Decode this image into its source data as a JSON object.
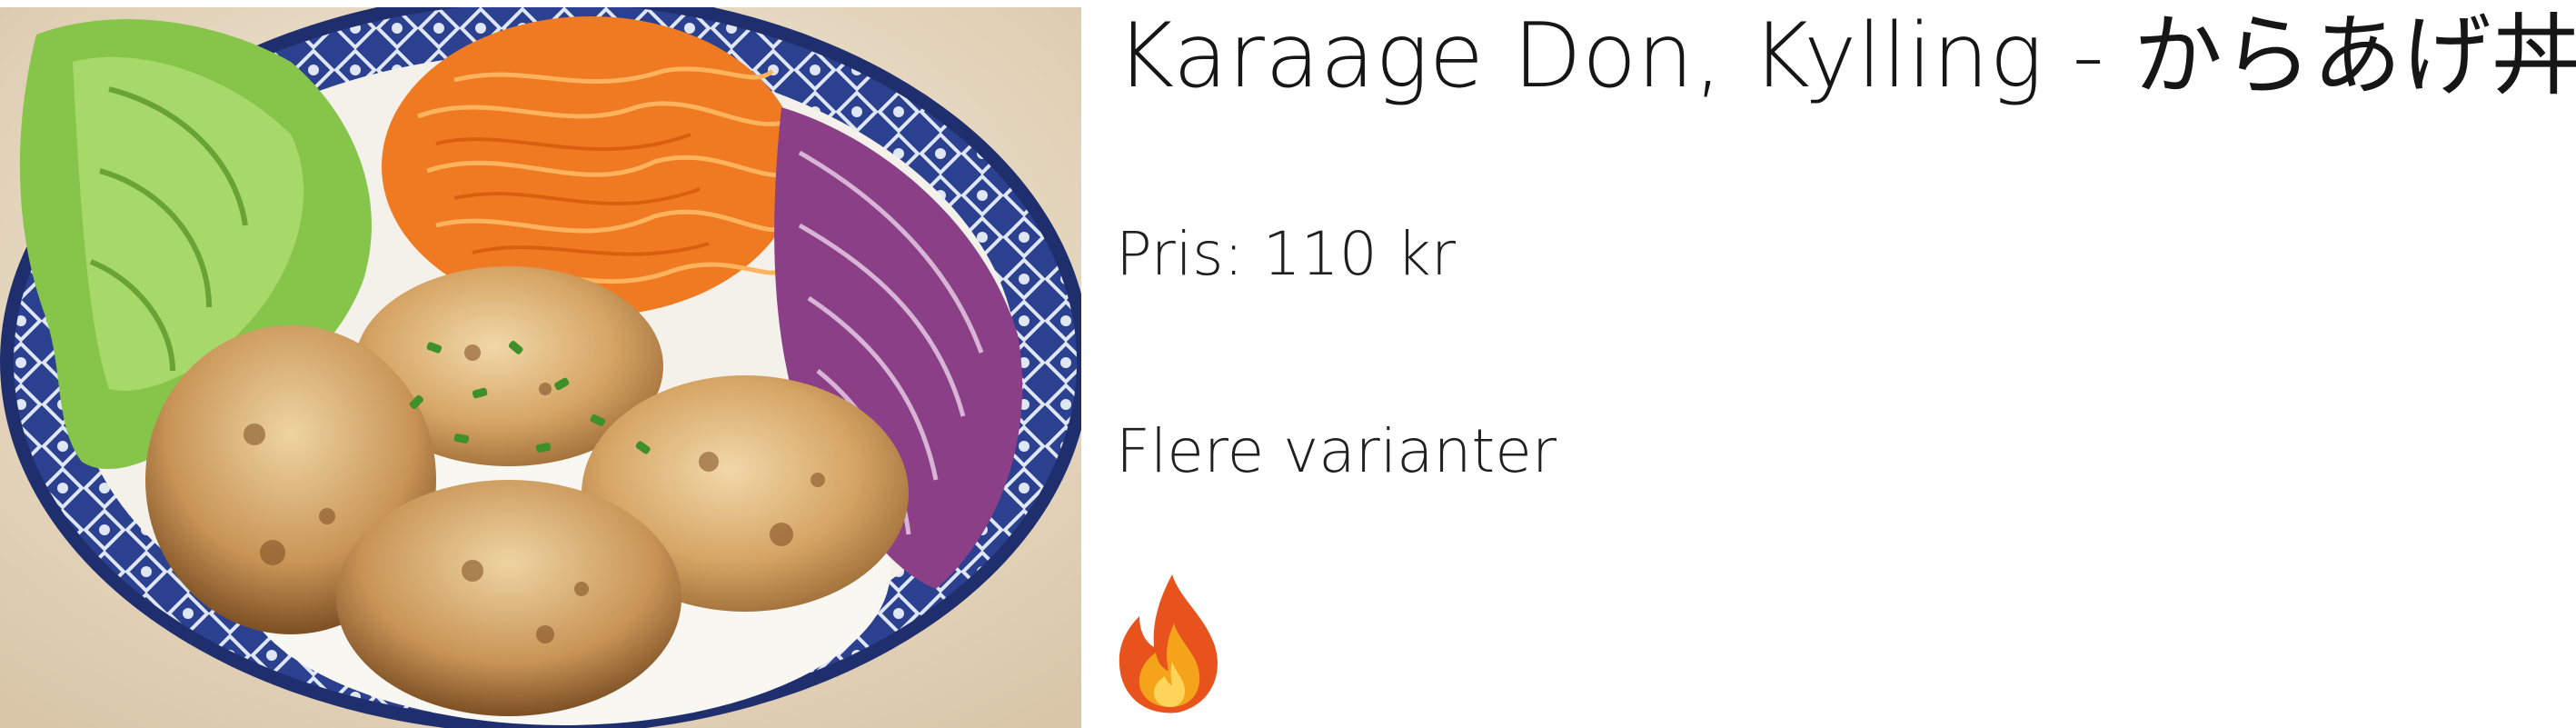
{
  "product": {
    "title": "Karaage Don, Kylling - からあげ丼",
    "price": "Pris: 110 kr",
    "variants": "Flere varianter",
    "spicy_icon": "fire-icon",
    "image": "karaage-don-bowl-photo"
  },
  "colors": {
    "text": "#1c1c1c",
    "flame_outer": "#e8521c",
    "flame_inner": "#f6a31c",
    "bowl_blue": "#2a3f8c"
  }
}
